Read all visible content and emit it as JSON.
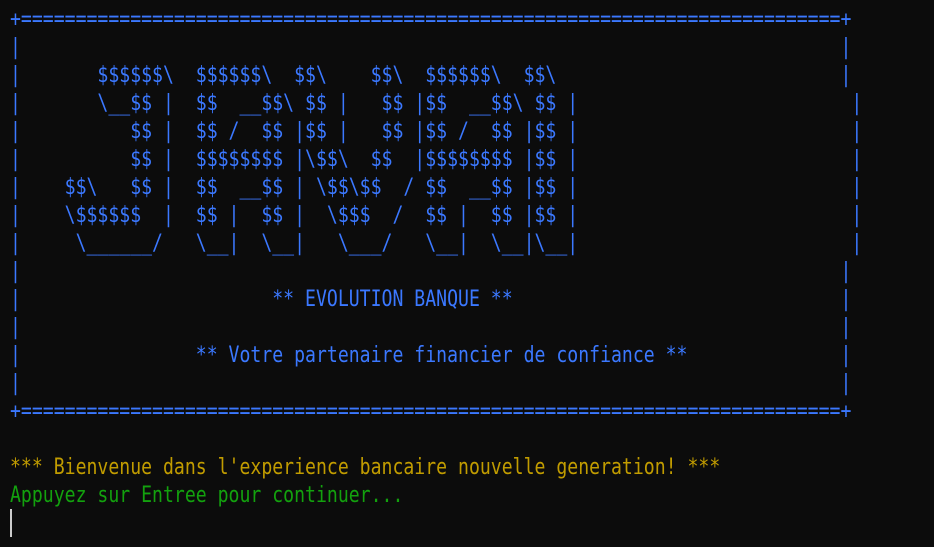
{
  "banner": {
    "lines": [
      "+===========================================================================+",
      "|                                                                           |",
      "|       $$$$$$\\  $$$$$$\\  $$\\    $$\\  $$$$$$\\  $$\\                          |",
      "|       \\__$$ |  $$  __$$\\ $$ |   $$ |$$  __$$\\ $$ |                         |",
      "|          $$ |  $$ /  $$ |$$ |   $$ |$$ /  $$ |$$ |                         |",
      "|          $$ |  $$$$$$$$ |\\$$\\  $$  |$$$$$$$$ |$$ |                         |",
      "|    $$\\   $$ |  $$  __$$ | \\$$\\$$  / $$  __$$ |$$ |                         |",
      "|    \\$$$$$$  |  $$ |  $$ |  \\$$$  /  $$ |  $$ |$$ |                         |",
      "|     \\______/   \\__|  \\__|   \\___/   \\__|  \\__|\\__|                         |",
      "|                                                                           |",
      "|                       ** EVOLUTION BANQUE **                              |",
      "|                                                                           |",
      "|                ** Votre partenaire financier de confiance **              |",
      "|                                                                           |",
      "+===========================================================================+"
    ]
  },
  "messages": {
    "blank": "",
    "welcome": "*** Bienvenue dans l'experience bancaire nouvelle generation! ***",
    "prompt": "Appuyez sur Entree pour continuer..."
  },
  "colors": {
    "banner": "#3b78ff",
    "welcome": "#c19c00",
    "prompt": "#13a10e",
    "background": "#0c0c0c"
  }
}
